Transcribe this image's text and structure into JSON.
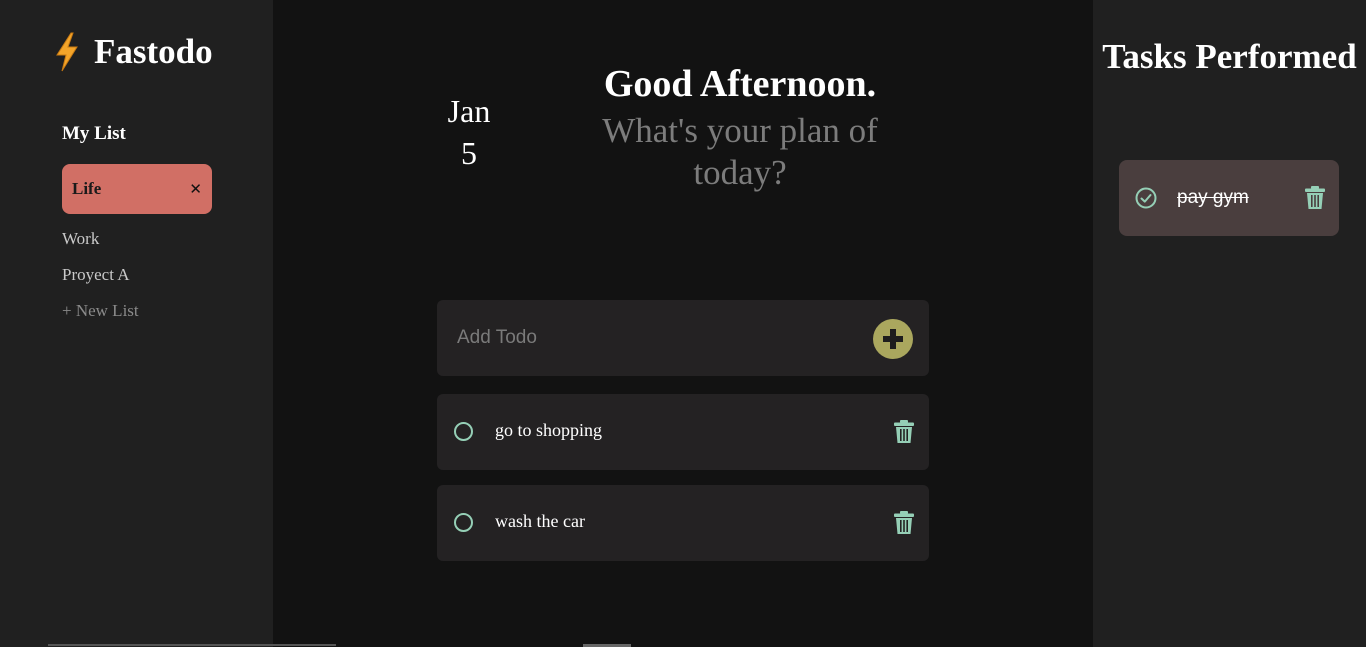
{
  "app": {
    "title": "Fastodo",
    "brand_icon": "lightning-bolt-icon"
  },
  "sidebar": {
    "section_title": "My List",
    "active_list": {
      "label": "Life",
      "close_icon": "close-icon",
      "close_glyph": "✕"
    },
    "lists": [
      {
        "label": "Work"
      },
      {
        "label": "Proyect A"
      }
    ],
    "new_list_label": "+ New List"
  },
  "header": {
    "date_month": "Jan",
    "date_day": "5",
    "greeting": "Good Afternoon.",
    "subtitle": "What's your plan of today?"
  },
  "add_todo": {
    "placeholder": "Add Todo",
    "button_icon": "plus-circle-icon"
  },
  "todos": [
    {
      "text": "go to shopping",
      "completed": false
    },
    {
      "text": "wash the car",
      "completed": false
    }
  ],
  "completed_panel": {
    "title": "Tasks Performed",
    "items": [
      {
        "text": "pay gym",
        "completed": true
      }
    ]
  },
  "colors": {
    "accent_active_list": "#d16f65",
    "add_button": "#aaa75e",
    "icon_mint": "#95cfb6",
    "done_card": "#4a3e3e"
  }
}
